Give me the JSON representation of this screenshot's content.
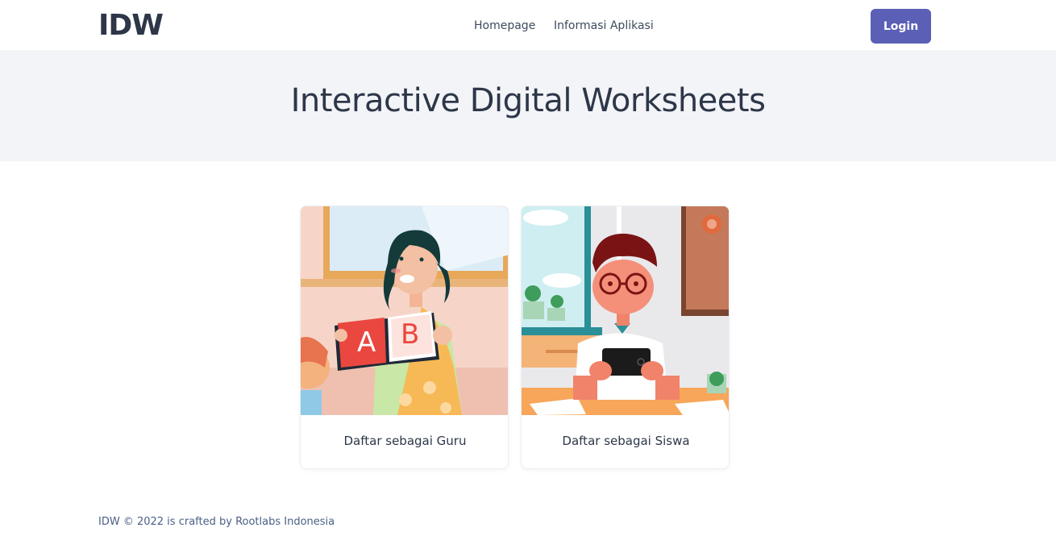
{
  "header": {
    "brand": "IDW",
    "nav": [
      {
        "label": "Homepage"
      },
      {
        "label": "Informasi Aplikasi"
      }
    ],
    "login_label": "Login"
  },
  "hero": {
    "title": "Interactive Digital Worksheets"
  },
  "cards": [
    {
      "label": "Daftar sebagai Guru",
      "image": "teacher-illustration"
    },
    {
      "label": "Daftar sebagai Siswa",
      "image": "student-illustration"
    }
  ],
  "footer": {
    "prefix": "IDW © 2022 is crafted by",
    "link_label": "Rootlabs Indonesia"
  },
  "colors": {
    "accent": "#5b5fb5",
    "hero_bg": "#f3f4f8",
    "text": "#2d3748",
    "footer_text": "#4a5f86"
  }
}
